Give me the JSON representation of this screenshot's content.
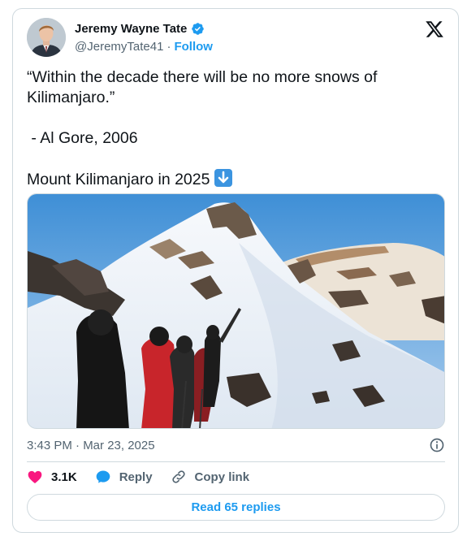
{
  "author": {
    "display_name": "Jeremy Wayne Tate",
    "handle": "@JeremyTate41",
    "separator": "·",
    "follow_label": "Follow"
  },
  "tweet": {
    "line1": "“Within the decade there will be no more snows of Kilimanjaro.”",
    "line2": " - Al Gore, 2006",
    "line3": "Mount Kilimanjaro in 2025"
  },
  "meta": {
    "timestamp": "3:43 PM · Mar 23, 2025"
  },
  "actions": {
    "like_count": "3.1K",
    "reply_label": "Reply",
    "copy_link_label": "Copy link"
  },
  "read_replies_label": "Read 65 replies",
  "colors": {
    "accent": "#1d9bf0",
    "like": "#f91880",
    "verified": "#1d9bf0",
    "text": "#0f1419",
    "secondary": "#536471",
    "border": "#cfd9de"
  },
  "icons": {
    "verified": "verified-badge-icon",
    "x_logo": "x-logo-icon",
    "arrow": "down-arrow-emoji-icon",
    "info": "info-icon",
    "like": "heart-icon",
    "reply": "speech-bubble-icon",
    "copy_link": "link-icon"
  }
}
